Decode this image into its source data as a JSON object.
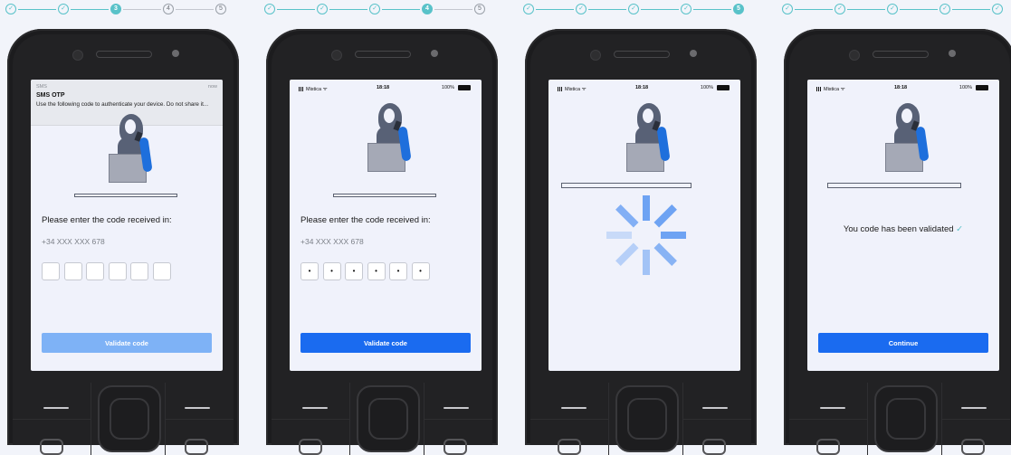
{
  "colors": {
    "teal": "#59c2c9",
    "primary": "#1a6bf0",
    "primary_disabled": "#7eb2f6",
    "spinner": "#6ea3f3"
  },
  "panels": [
    {
      "stepper": [
        "check",
        "check",
        "3",
        "4",
        "5"
      ],
      "sms": {
        "app": "SMS",
        "time": "now",
        "title": "SMS OTP",
        "body": "Use the following code to authenticate your device. Do not share it..."
      },
      "prompt": "Please enter the code received in:",
      "phone": "+34 XXX XXX 678",
      "otp": [
        "",
        "",
        "",
        "",
        "",
        ""
      ],
      "button": "Validate code"
    },
    {
      "stepper": [
        "check",
        "check",
        "check",
        "4",
        "5"
      ],
      "status": {
        "carrier": "Mistica",
        "time": "18:18",
        "battery": "100%"
      },
      "prompt": "Please enter the code received in:",
      "phone": "+34 XXX XXX 678",
      "otp": [
        "•",
        "•",
        "•",
        "•",
        "•",
        "•"
      ],
      "button": "Validate code"
    },
    {
      "stepper": [
        "check",
        "check",
        "check",
        "check",
        "5"
      ],
      "status": {
        "carrier": "Mistica",
        "time": "18:18",
        "battery": "100%"
      }
    },
    {
      "stepper": [
        "check",
        "check",
        "check",
        "check",
        "check"
      ],
      "status": {
        "carrier": "Mistica",
        "time": "18:18",
        "battery": "100%"
      },
      "message": "You code has been validated",
      "button": "Continue"
    }
  ]
}
